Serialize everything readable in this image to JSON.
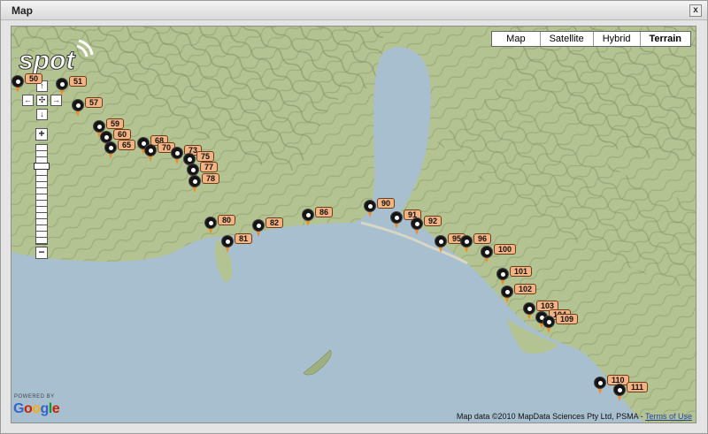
{
  "window": {
    "title": "Map",
    "close_label": "x"
  },
  "map_type": {
    "buttons": [
      {
        "label": "Map",
        "active": false
      },
      {
        "label": "Satellite",
        "active": false
      },
      {
        "label": "Hybrid",
        "active": false
      },
      {
        "label": "Terrain",
        "active": true
      }
    ]
  },
  "logo": {
    "text": "spot"
  },
  "controls": {
    "pan_up": "↑",
    "pan_left": "←",
    "pan_center": "✣",
    "pan_right": "→",
    "pan_down": "↓",
    "zoom_in": "+",
    "zoom_out": "−",
    "zoom_level_fraction": 0.2
  },
  "markers": [
    "50",
    "51",
    "57",
    "59",
    "60",
    "65",
    "68",
    "70",
    "73",
    "75",
    "77",
    "78",
    "80",
    "81",
    "82",
    "86",
    "90",
    "91",
    "92",
    "95",
    "96",
    "100",
    "101",
    "102",
    "103",
    "104",
    "109",
    "110",
    "111"
  ],
  "footer": {
    "powered_by": "POWERED BY",
    "google": [
      "G",
      "o",
      "o",
      "g",
      "l",
      "e"
    ],
    "google_colors": [
      "#3366cc",
      "#cc2200",
      "#ffaa00",
      "#3366cc",
      "#119922",
      "#cc2200"
    ],
    "attribution": "Map data ©2010 MapData Sciences Pty Ltd, PSMA -",
    "terms": "Terms of Use"
  },
  "colors": {
    "water": "#a8bfcf",
    "land": "#b4c392",
    "marker": "#151515",
    "label": "#f4b383"
  }
}
